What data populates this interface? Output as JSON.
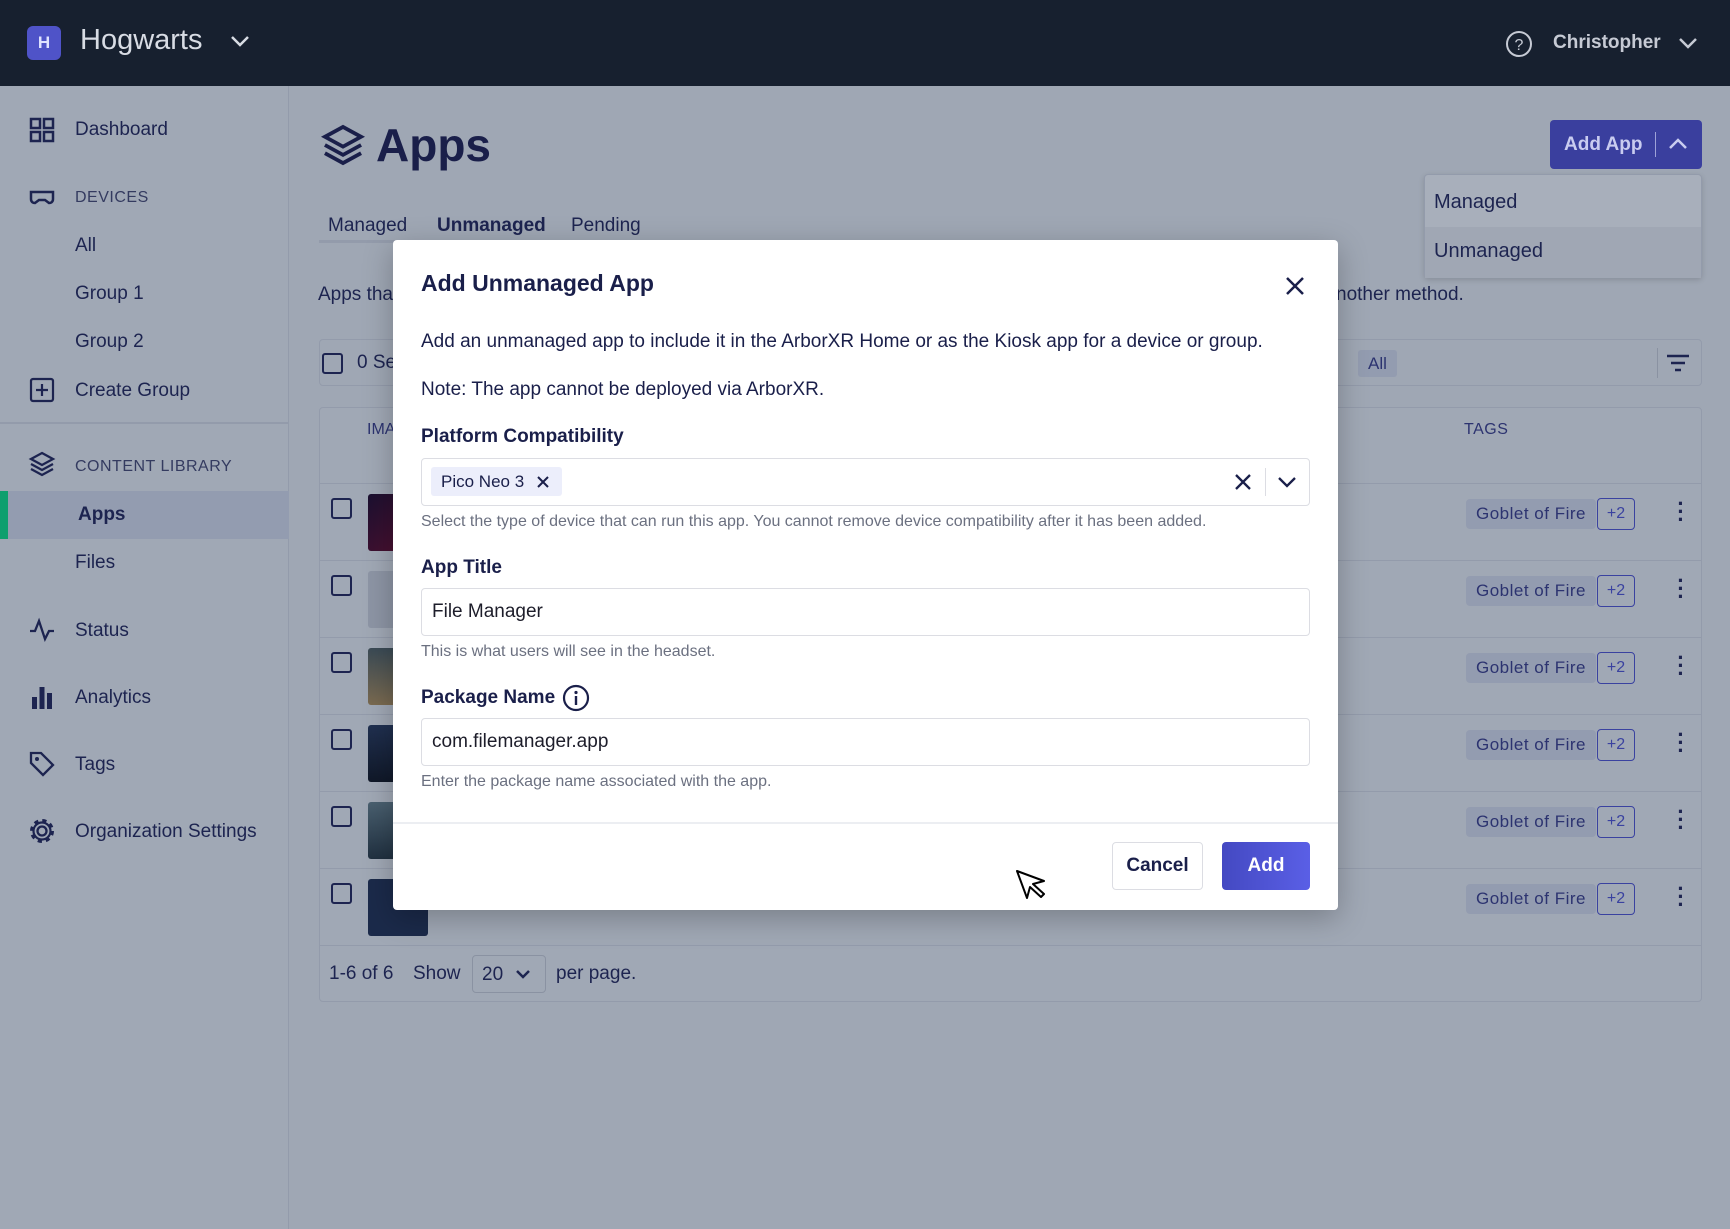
{
  "topbar": {
    "org_initial": "H",
    "org_name": "Hogwarts",
    "user_name": "Christopher",
    "help_icon": "help-circle-icon"
  },
  "sidebar": {
    "dashboard": "Dashboard",
    "devices_header": "DEVICES",
    "devices": [
      "All",
      "Group 1",
      "Group 2"
    ],
    "create_group": "Create Group",
    "content_header": "CONTENT LIBRARY",
    "content": [
      "Apps",
      "Files"
    ],
    "status": "Status",
    "analytics": "Analytics",
    "tags": "Tags",
    "org_settings": "Organization Settings",
    "active_item": "Apps",
    "accent": "#0e9f6e"
  },
  "page": {
    "title": "Apps",
    "tabs": [
      "Managed",
      "Unmanaged",
      "Pending"
    ],
    "active_tab": "Unmanaged",
    "description_left": "Apps tha",
    "description_right": "nother method.",
    "selected_label": "0 Se",
    "filter_chip": "All",
    "add_app": {
      "label": "Add App",
      "menu": [
        "Managed",
        "Unmanaged"
      ]
    },
    "table": {
      "col_image": "IMA",
      "col_tags": "TAGS",
      "rows": [
        {
          "tag": "Goblet of Fire",
          "more": "+2"
        },
        {
          "tag": "Goblet of Fire",
          "more": "+2"
        },
        {
          "tag": "Goblet of Fire",
          "more": "+2"
        },
        {
          "tag": "Goblet of Fire",
          "more": "+2"
        },
        {
          "tag": "Goblet of Fire",
          "more": "+2"
        },
        {
          "tag": "Goblet of Fire",
          "more": "+2"
        }
      ]
    },
    "pagination": {
      "range": "1-6 of 6",
      "show": "Show",
      "per_page_value": "20",
      "per_page": "per page."
    }
  },
  "modal": {
    "title": "Add Unmanaged App",
    "intro": "Add an unmanaged app to include it in the ArborXR Home or as the Kiosk app for a device or group.",
    "note": "Note: The app cannot be deployed via ArborXR.",
    "platform": {
      "label": "Platform Compatibility",
      "chip": "Pico Neo 3",
      "help": "Select the type of device that can run this app. You cannot remove device compatibility after it has been added."
    },
    "app_title": {
      "label": "App Title",
      "value": "File Manager",
      "help": "This is what users will see in the headset."
    },
    "package": {
      "label": "Package Name",
      "value": "com.filemanager.app",
      "help": "Enter the package name associated with the app."
    },
    "cancel": "Cancel",
    "add": "Add",
    "primary_color": "#4a4fd0"
  }
}
